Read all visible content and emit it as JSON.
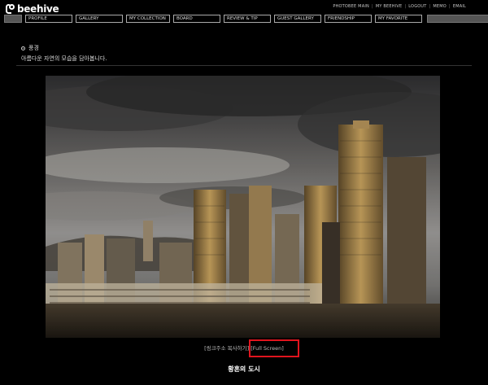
{
  "header": {
    "logo_text": "beehive",
    "top_links": [
      "PHOTOBEE MAIN",
      "MY BEEHIVE",
      "LOGOUT",
      "MEMO",
      "EMAIL"
    ],
    "nav": [
      "PROFILE",
      "GALLERY",
      "MY COLLECTION",
      "BOARD",
      "REVIEW & TIP",
      "GUEST GALLERY",
      "FRIENDSHIP",
      "MY FAVORITE"
    ]
  },
  "content": {
    "category": "풍경",
    "description": "아름다운 자연의 모습을 담아봅니다.",
    "copy_link": "[링크주소 복사하기]",
    "full_screen": "[Full Screen]",
    "photo_caption": "황혼의 도시"
  },
  "colors": {
    "background": "#000000",
    "highlight_box": "#e0141e"
  }
}
